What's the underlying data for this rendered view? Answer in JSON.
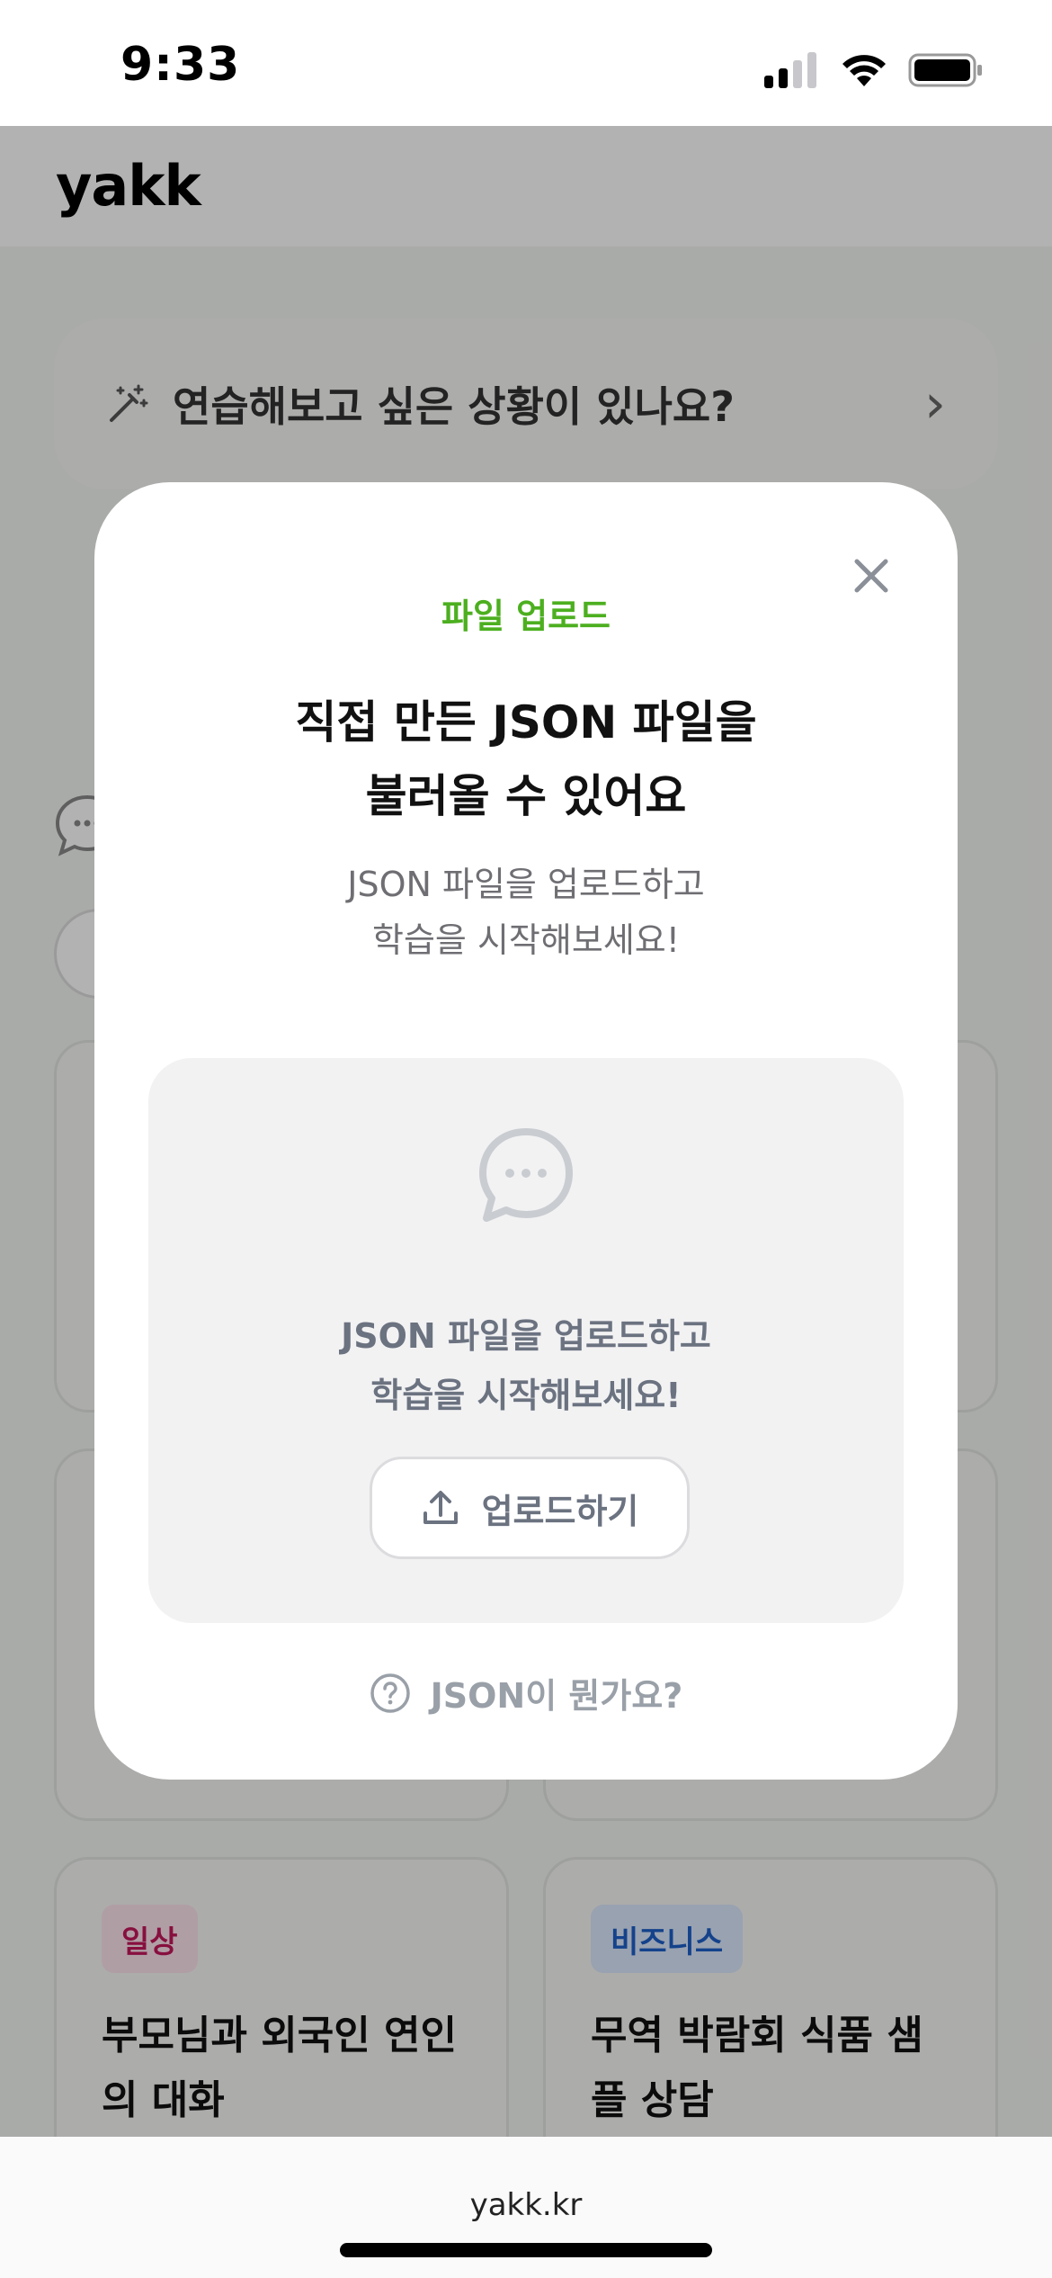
{
  "status_bar": {
    "time": "9:33"
  },
  "app": {
    "logo": "yakk",
    "practice_prompt": "연습해보고 싶은 상황이 있나요?",
    "cards": [
      {
        "tag": "일상",
        "title": "부모님과 외국인 연인의 대화"
      },
      {
        "tag": "비즈니스",
        "title": "무역 박람회 식품 샘플 상담"
      }
    ]
  },
  "modal": {
    "eyebrow": "파일 업로드",
    "title_line1": "직접 만든 JSON 파일을",
    "title_line2": "불러올 수 있어요",
    "desc_line1": "JSON 파일을 업로드하고",
    "desc_line2": "학습을 시작해보세요!",
    "dropzone_line1": "JSON 파일을 업로드하고",
    "dropzone_line2": "학습을 시작해보세요!",
    "upload_button": "업로드하기",
    "help_link": "JSON이 뭔가요?"
  },
  "browser": {
    "url": "yakk.kr"
  },
  "colors": {
    "accent": "#4caf1f",
    "muted": "#6b7280"
  }
}
